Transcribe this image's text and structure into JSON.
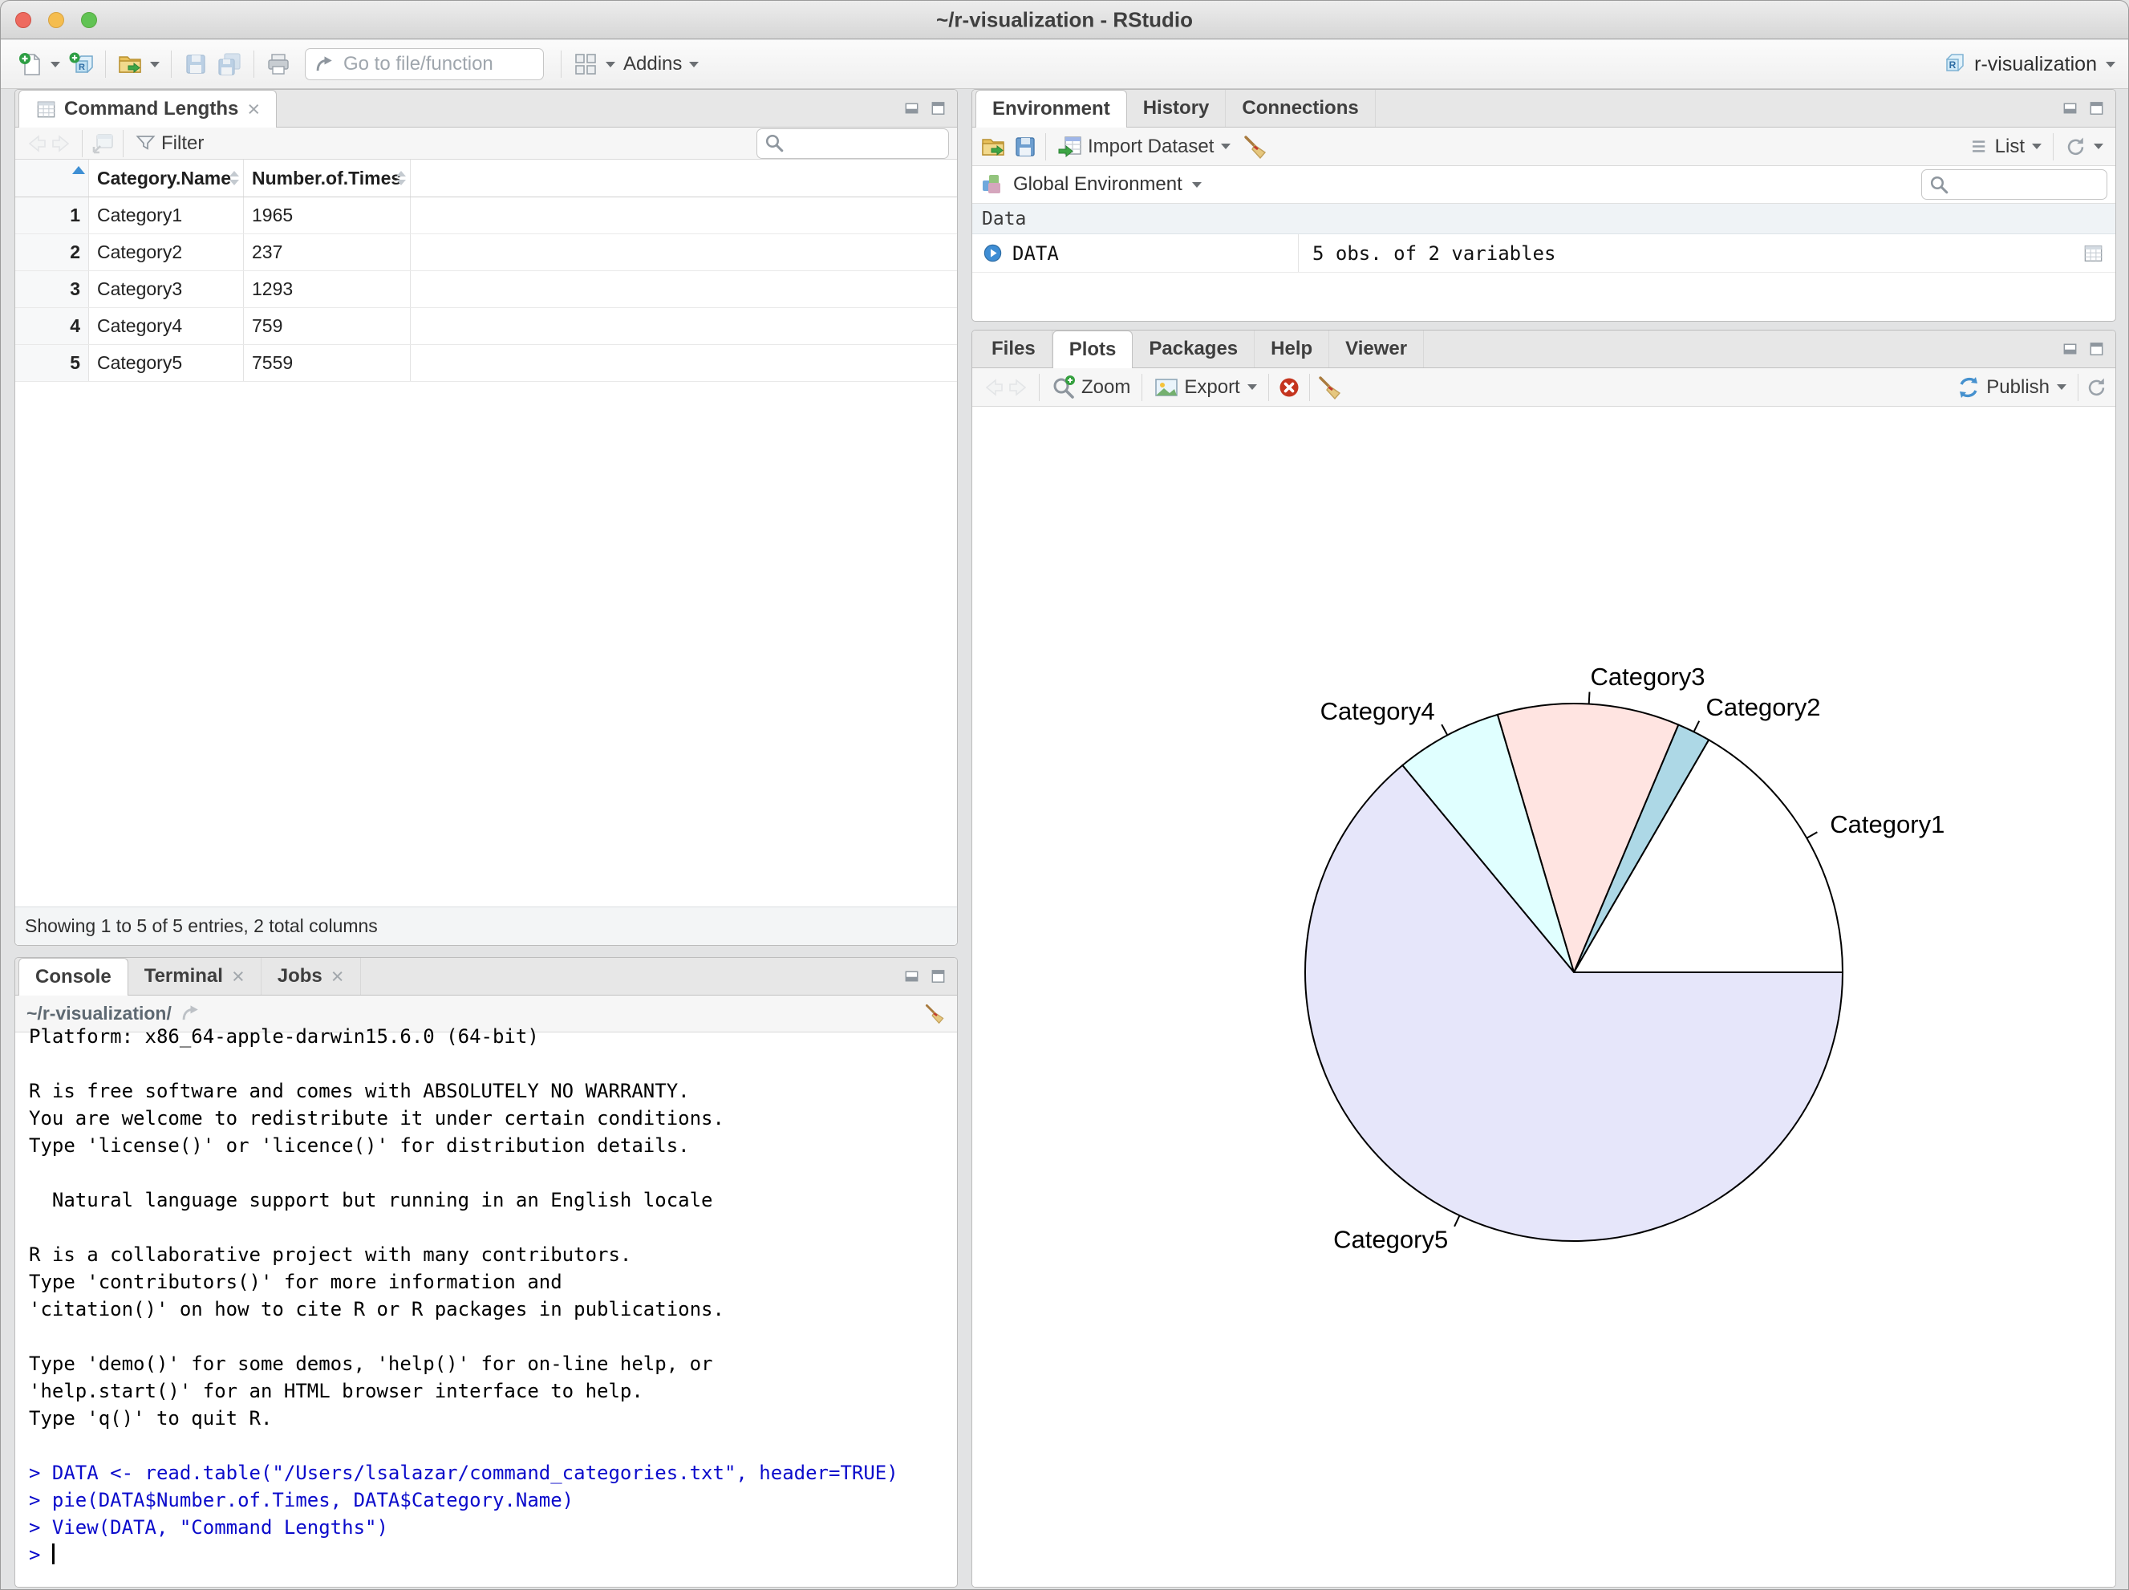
{
  "window": {
    "title": "~/r-visualization - RStudio",
    "project": "r-visualization"
  },
  "main_toolbar": {
    "goto_placeholder": "Go to file/function",
    "addins_label": "Addins"
  },
  "data_viewer": {
    "tab_label": "Command Lengths",
    "filter_label": "Filter",
    "search_value": "",
    "status": "Showing 1 to 5 of 5 entries, 2 total columns",
    "table": {
      "columns": [
        "Category.Name",
        "Number.of.Times"
      ],
      "rows": [
        {
          "num": "1",
          "name": "Category1",
          "times": "1965"
        },
        {
          "num": "2",
          "name": "Category2",
          "times": "237"
        },
        {
          "num": "3",
          "name": "Category3",
          "times": "1293"
        },
        {
          "num": "4",
          "name": "Category4",
          "times": "759"
        },
        {
          "num": "5",
          "name": "Category5",
          "times": "7559"
        }
      ]
    }
  },
  "environment": {
    "tabs": [
      "Environment",
      "History",
      "Connections"
    ],
    "import_label": "Import Dataset",
    "list_label": "List",
    "scope_label": "Global Environment",
    "section_label": "Data",
    "objects": [
      {
        "name": "DATA",
        "value": "5 obs. of 2 variables"
      }
    ],
    "search_value": ""
  },
  "plots": {
    "tabs": [
      "Files",
      "Plots",
      "Packages",
      "Help",
      "Viewer"
    ],
    "zoom_label": "Zoom",
    "export_label": "Export",
    "publish_label": "Publish"
  },
  "console": {
    "tabs": [
      "Console",
      "Terminal",
      "Jobs"
    ],
    "working_dir": "~/r-visualization/",
    "output_lines": [
      "Platform: x86_64-apple-darwin15.6.0 (64-bit)",
      "",
      "R is free software and comes with ABSOLUTELY NO WARRANTY.",
      "You are welcome to redistribute it under certain conditions.",
      "Type 'license()' or 'licence()' for distribution details.",
      "",
      "  Natural language support but running in an English locale",
      "",
      "R is a collaborative project with many contributors.",
      "Type 'contributors()' for more information and",
      "'citation()' on how to cite R or R packages in publications.",
      "",
      "Type 'demo()' for some demos, 'help()' for on-line help, or",
      "'help.start()' for an HTML browser interface to help.",
      "Type 'q()' to quit R.",
      ""
    ],
    "input_lines": [
      "> DATA <- read.table(\"/Users/lsalazar/command_categories.txt\", header=TRUE)",
      "> pie(DATA$Number.of.Times, DATA$Category.Name)",
      "> View(DATA, \"Command Lengths\")"
    ],
    "prompt": ">"
  },
  "chart_data": {
    "type": "pie",
    "title": "",
    "categories": [
      "Category1",
      "Category2",
      "Category3",
      "Category4",
      "Category5"
    ],
    "values": [
      1965,
      237,
      1293,
      759,
      7559
    ],
    "colors": [
      "#FFFFFF",
      "#ADD8E6",
      "#FFE4E1",
      "#E0FFFF",
      "#E6E6FA"
    ],
    "start_angle_deg": 0,
    "direction": "counterclockwise",
    "stroke": "#000000",
    "label_color": "#000000",
    "legend": "none"
  },
  "colors": {
    "console_input": "#0B0BCB",
    "sort_active": "#3E8FD4"
  }
}
